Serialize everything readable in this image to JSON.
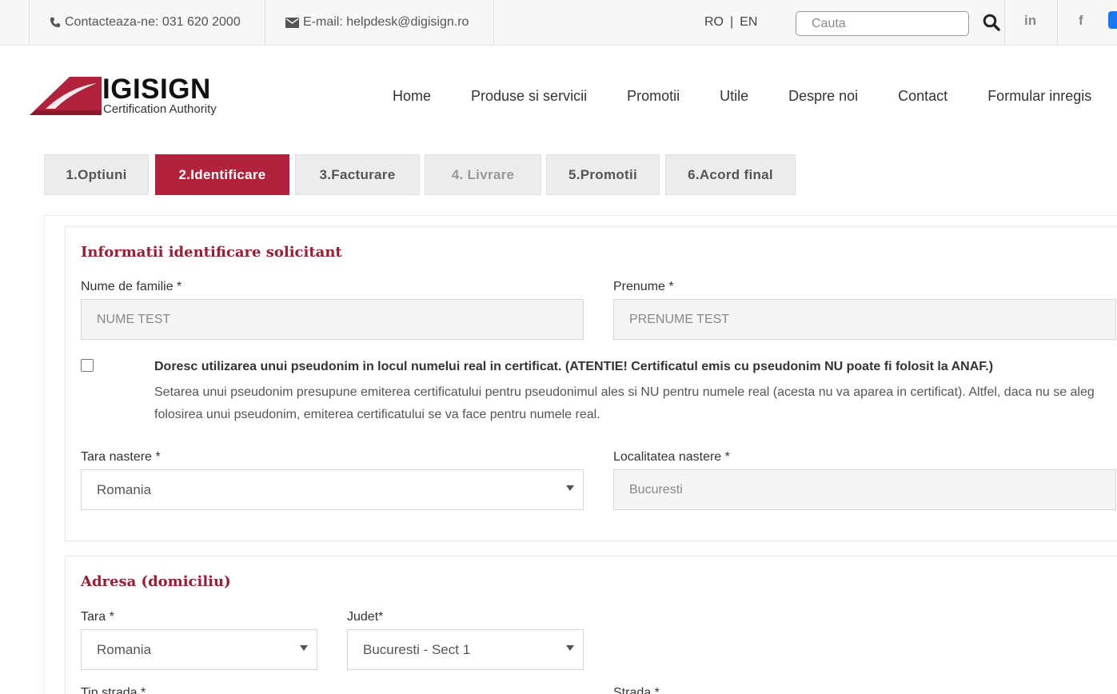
{
  "topbar": {
    "contact": "Contacteaza-ne: 031 620 2000",
    "email": "E-mail: helpdesk@digisign.ro",
    "lang_ro": "RO",
    "lang_sep": "|",
    "lang_en": "EN",
    "search_placeholder": "Cauta",
    "social": {
      "linkedin": "in",
      "facebook": "f"
    },
    "icons": [
      "phone-icon",
      "envelope-icon",
      "search-icon",
      "linkedin-icon",
      "facebook-icon"
    ]
  },
  "header": {
    "logo_main": "IGISIGN",
    "logo_sub": "Certification Authority",
    "nav": [
      "Home",
      "Produse si servicii",
      "Promotii",
      "Utile",
      "Despre noi",
      "Contact",
      "Formular inregis"
    ]
  },
  "steps": [
    {
      "label": "1.Optiuni",
      "state": "normal"
    },
    {
      "label": "2.Identificare",
      "state": "active"
    },
    {
      "label": "3.Facturare",
      "state": "normal"
    },
    {
      "label": "4. Livrare",
      "state": "disabled"
    },
    {
      "label": "5.Promotii",
      "state": "normal"
    },
    {
      "label": "6.Acord final",
      "state": "normal"
    }
  ],
  "identification": {
    "title": "Informatii identificare solicitant",
    "last_name_label": "Nume de familie *",
    "last_name_value": "NUME TEST",
    "first_name_label": "Prenume *",
    "first_name_value": "PRENUME TEST",
    "pseudonym_bold": "Doresc utilizarea unui pseudonim in locul numelui real in certificat. (ATENTIE! Certificatul emis cu pseudonim NU poate fi folosit la ANAF.)",
    "pseudonym_line1": "Setarea unui pseudonim presupune emiterea certificatului pentru pseudonimul ales si NU pentru numele real (acesta nu va aparea in certificat). Altfel, daca nu se aleg",
    "pseudonym_line2": "folosirea unui pseudonim, emiterea certificatului se va face pentru numele real.",
    "birth_country_label": "Tara nastere *",
    "birth_country_value": "Romania",
    "birth_city_label": "Localitatea nastere *",
    "birth_city_value": "Bucuresti"
  },
  "address": {
    "title": "Adresa (domiciliu)",
    "country_label": "Tara *",
    "country_value": "Romania",
    "county_label": "Judet*",
    "county_value": "Bucuresti - Sect 1",
    "street_type_label": "Tip strada *",
    "street_label": "Strada *"
  },
  "colors": {
    "accent": "#b2223c",
    "title": "#9b1c33",
    "facebook_blue": "#1877f2"
  }
}
